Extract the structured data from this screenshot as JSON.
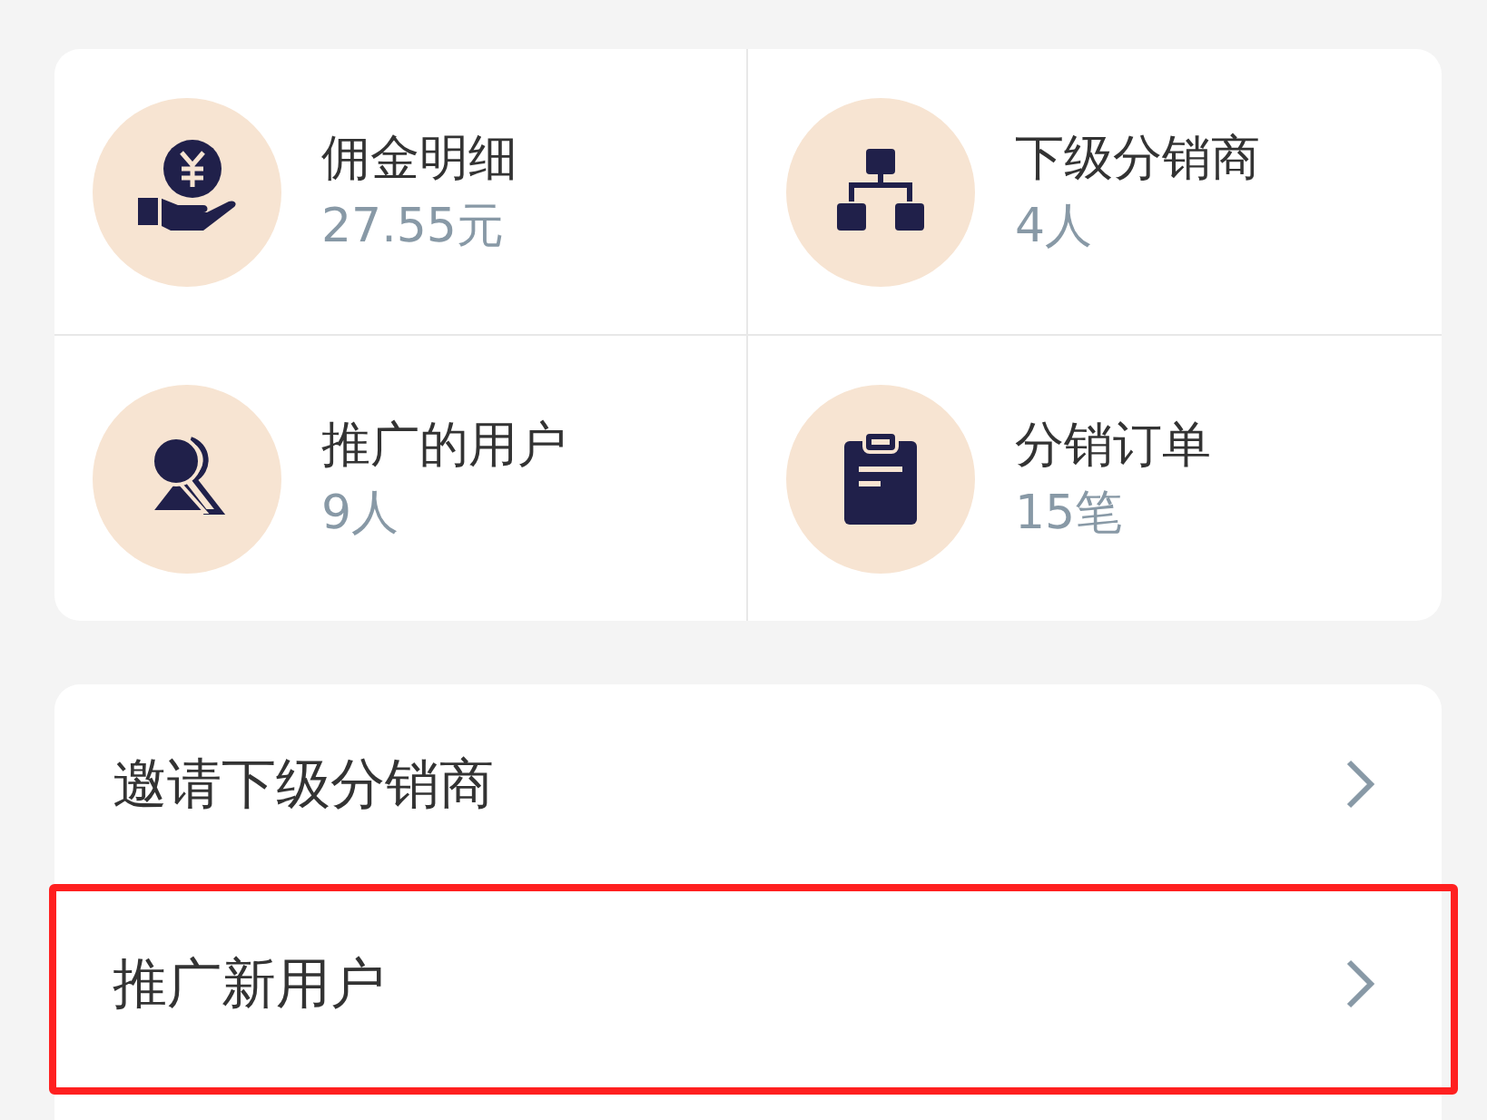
{
  "stats": [
    {
      "title": "佣金明细",
      "value": "27.55元"
    },
    {
      "title": "下级分销商",
      "value": "4人"
    },
    {
      "title": "推广的用户",
      "value": "9人"
    },
    {
      "title": "分销订单",
      "value": "15笔"
    }
  ],
  "menu": [
    {
      "label": "邀请下级分销商",
      "highlighted": false
    },
    {
      "label": "推广新用户",
      "highlighted": true
    }
  ]
}
